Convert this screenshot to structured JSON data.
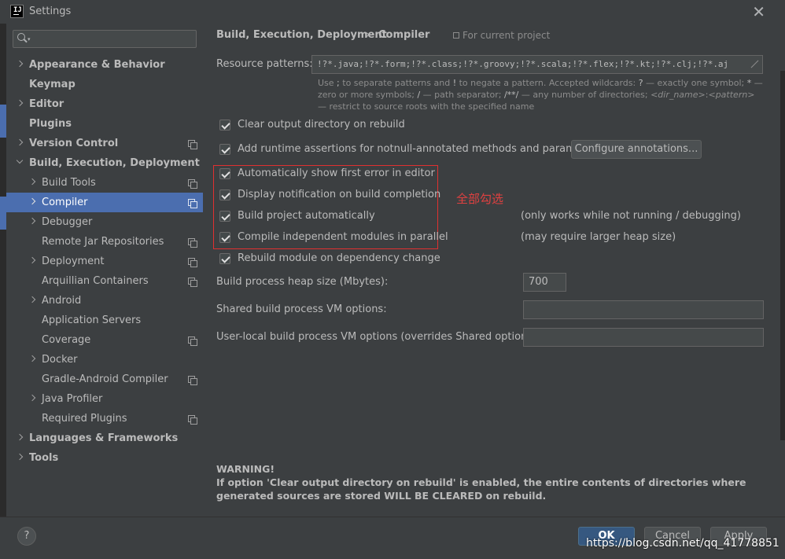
{
  "window": {
    "title": "Settings",
    "logo_text": "IJ"
  },
  "sidebar": {
    "search_placeholder": "",
    "items": [
      {
        "label": "Appearance & Behavior",
        "bold": true,
        "arrow": "right",
        "indent": 0,
        "proj": false
      },
      {
        "label": "Keymap",
        "bold": true,
        "arrow": "none",
        "indent": 0,
        "proj": false
      },
      {
        "label": "Editor",
        "bold": true,
        "arrow": "right",
        "indent": 0,
        "proj": false
      },
      {
        "label": "Plugins",
        "bold": true,
        "arrow": "none",
        "indent": 0,
        "proj": false
      },
      {
        "label": "Version Control",
        "bold": true,
        "arrow": "right",
        "indent": 0,
        "proj": true
      },
      {
        "label": "Build, Execution, Deployment",
        "bold": true,
        "arrow": "down",
        "indent": 0,
        "proj": false
      },
      {
        "label": "Build Tools",
        "bold": false,
        "arrow": "right",
        "indent": 1,
        "proj": true
      },
      {
        "label": "Compiler",
        "bold": false,
        "arrow": "right",
        "indent": 1,
        "proj": true,
        "selected": true
      },
      {
        "label": "Debugger",
        "bold": false,
        "arrow": "right",
        "indent": 1,
        "proj": false
      },
      {
        "label": "Remote Jar Repositories",
        "bold": false,
        "arrow": "none",
        "indent": 1,
        "proj": true
      },
      {
        "label": "Deployment",
        "bold": false,
        "arrow": "right",
        "indent": 1,
        "proj": true
      },
      {
        "label": "Arquillian Containers",
        "bold": false,
        "arrow": "none",
        "indent": 1,
        "proj": true
      },
      {
        "label": "Android",
        "bold": false,
        "arrow": "right",
        "indent": 1,
        "proj": false
      },
      {
        "label": "Application Servers",
        "bold": false,
        "arrow": "none",
        "indent": 1,
        "proj": false
      },
      {
        "label": "Coverage",
        "bold": false,
        "arrow": "none",
        "indent": 1,
        "proj": true
      },
      {
        "label": "Docker",
        "bold": false,
        "arrow": "right",
        "indent": 1,
        "proj": false
      },
      {
        "label": "Gradle-Android Compiler",
        "bold": false,
        "arrow": "none",
        "indent": 1,
        "proj": true
      },
      {
        "label": "Java Profiler",
        "bold": false,
        "arrow": "right",
        "indent": 1,
        "proj": false
      },
      {
        "label": "Required Plugins",
        "bold": false,
        "arrow": "none",
        "indent": 1,
        "proj": true
      },
      {
        "label": "Languages & Frameworks",
        "bold": true,
        "arrow": "right",
        "indent": 0,
        "proj": false
      },
      {
        "label": "Tools",
        "bold": true,
        "arrow": "right",
        "indent": 0,
        "proj": false
      }
    ]
  },
  "header": {
    "breadcrumb_parent": "Build, Execution, Deployment",
    "breadcrumb_sep": "›",
    "breadcrumb_current": "Compiler",
    "scope_label": "For current project"
  },
  "resource": {
    "label": "Resource patterns:",
    "value": "!?*.java;!?*.form;!?*.class;!?*.groovy;!?*.scala;!?*.flex;!?*.kt;!?*.clj;!?*.aj",
    "hint_1": "Use ",
    "hint_semi": ";",
    "hint_2": " to separate patterns and ",
    "hint_bang": "!",
    "hint_3": " to negate a pattern. Accepted wildcards: ",
    "hint_q": "?",
    "hint_4": " — exactly one symbol; ",
    "hint_star": "*",
    "hint_5": " — zero or more symbols; ",
    "hint_slash": "/",
    "hint_6": " — path separator; ",
    "hint_dstar": "/**/",
    "hint_7": " — any number of directories; ",
    "hint_dir": "<dir_name>",
    "hint_colon": ":",
    "hint_pattern": "<pattern>",
    "hint_8": " — restrict to source roots with the specified name"
  },
  "options": {
    "clear_output": "Clear output directory on rebuild",
    "runtime_assertions": "Add runtime assertions for notnull-annotated methods and parameters",
    "configure_annotations": "Configure annotations...",
    "show_first_error": "Automatically show first error in editor",
    "display_notification": "Display notification on build completion",
    "build_automatically": "Build project automatically",
    "compile_parallel": "Compile independent modules in parallel",
    "rebuild_on_change": "Rebuild module on dependency change",
    "note_auto": "(only works while not running / debugging)",
    "note_parallel": "(may require larger heap size)"
  },
  "annotation": "全部勾选",
  "heap": {
    "label": "Build process heap size (Mbytes):",
    "value": "700"
  },
  "vm_options": {
    "shared_label": "Shared build process VM options:",
    "shared_value": "",
    "local_label": "User-local build process VM options (overrides Shared options):",
    "local_value": ""
  },
  "warning": {
    "title": "WARNING!",
    "text": "If option 'Clear output directory on rebuild' is enabled, the entire contents of directories where generated sources are stored WILL BE CLEARED on rebuild."
  },
  "footer": {
    "help": "?",
    "ok": "OK",
    "cancel": "Cancel",
    "apply": "Apply",
    "watermark": "https://blog.csdn.net/qq_41778851"
  },
  "colors": {
    "background": "#3c3f41",
    "selection": "#4b6eaf",
    "annotation_red": "#e03030",
    "primary_button": "#365880"
  }
}
